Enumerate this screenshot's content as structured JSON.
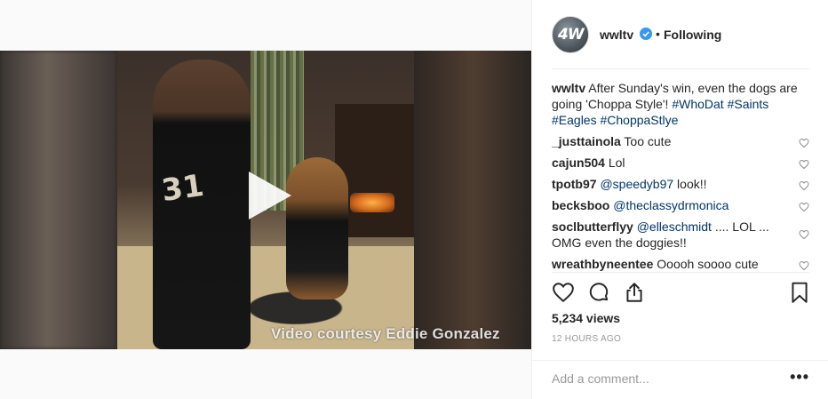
{
  "post": {
    "username": "wwltv",
    "avatar_text": "4W",
    "separator": "•",
    "following_label": "Following",
    "caption": {
      "username": "wwltv",
      "text": " After Sunday's win, even the dogs are going 'Choppa Style'! ",
      "tags": [
        "#WhoDat",
        "#Saints",
        "#Eagles",
        "#ChoppaStlye"
      ]
    },
    "comments": [
      {
        "username": "_justtainola",
        "mention": "",
        "text": " Too cute"
      },
      {
        "username": "cajun504",
        "mention": "",
        "text": " Lol"
      },
      {
        "username": "tpotb97",
        "mention": "@speedyb97",
        "text": " look!!"
      },
      {
        "username": "becksboo",
        "mention": "@theclassydrmonica",
        "text": ""
      },
      {
        "username": "soclbutterflyy",
        "mention": "@elleschmidt",
        "text": " .... LOL ... OMG even the doggies!!"
      },
      {
        "username": "wreathbyneentee",
        "mention": "",
        "text": " Ooooh soooo cute"
      }
    ],
    "views": "5,234 views",
    "time": "12 HOURS AGO",
    "add_comment_placeholder": "Add a comment...",
    "more_label": "•••"
  },
  "video": {
    "watermark": "Video courtesy Eddie Gonzalez",
    "jersey_number": "31"
  },
  "colors": {
    "link": "#003569",
    "verified": "#3897f0",
    "muted": "#999999"
  },
  "icons": [
    "play-icon",
    "verified-icon",
    "heart-icon",
    "comment-icon",
    "share-icon",
    "bookmark-icon",
    "more-icon"
  ]
}
